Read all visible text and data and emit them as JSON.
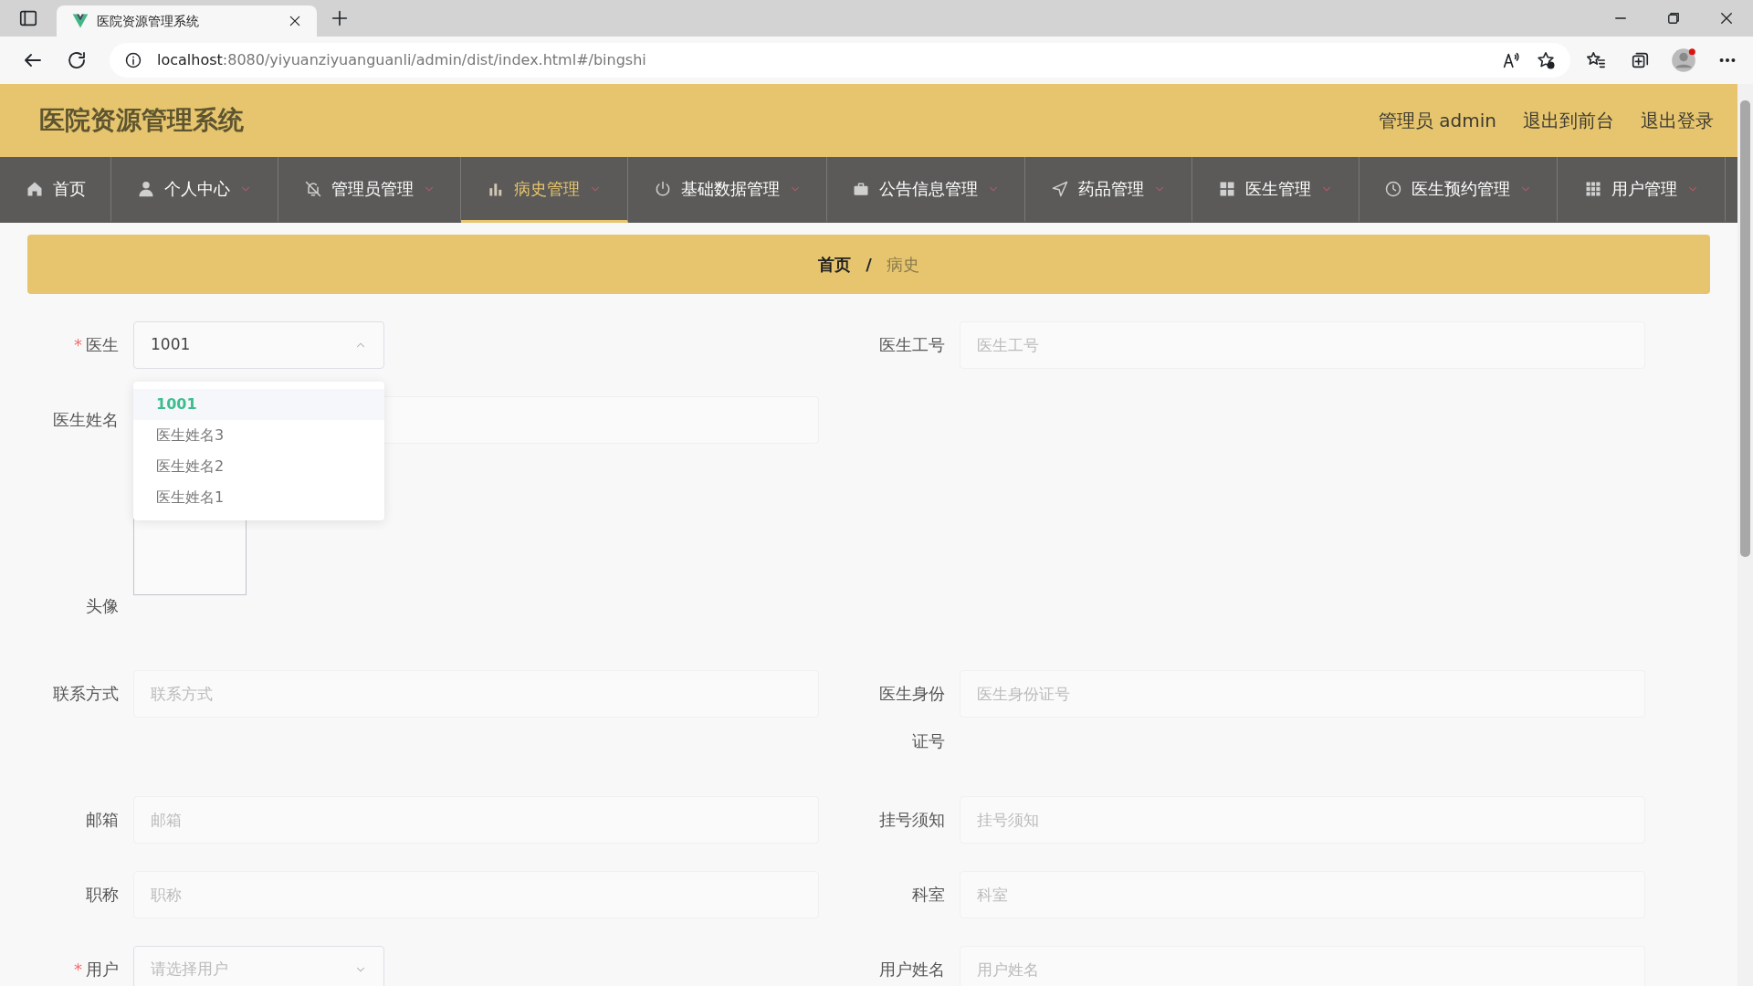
{
  "browser": {
    "tab_title": "医院资源管理系统",
    "url_host": "localhost",
    "url_rest": ":8080/yiyuanziyuanguanli/admin/dist/index.html#/bingshi"
  },
  "header": {
    "title": "医院资源管理系统",
    "user_label": "管理员 admin",
    "links": [
      "退出到前台",
      "退出登录"
    ]
  },
  "nav": [
    {
      "label": "首页",
      "dropdown": false,
      "selected": false
    },
    {
      "label": "个人中心",
      "dropdown": true,
      "selected": false
    },
    {
      "label": "管理员管理",
      "dropdown": true,
      "selected": false
    },
    {
      "label": "病史管理",
      "dropdown": true,
      "selected": true
    },
    {
      "label": "基础数据管理",
      "dropdown": true,
      "selected": false
    },
    {
      "label": "公告信息管理",
      "dropdown": true,
      "selected": false
    },
    {
      "label": "药品管理",
      "dropdown": true,
      "selected": false
    },
    {
      "label": "医生管理",
      "dropdown": true,
      "selected": false
    },
    {
      "label": "医生预约管理",
      "dropdown": true,
      "selected": false
    },
    {
      "label": "用户管理",
      "dropdown": true,
      "selected": false
    }
  ],
  "breadcrumb": {
    "separator": "/",
    "items": [
      {
        "label": "首页",
        "current": false
      },
      {
        "label": "病史",
        "current": true
      }
    ]
  },
  "form": {
    "rows": [
      {
        "left": {
          "kind": "select",
          "required_mark": "*",
          "label": "医生",
          "value": "1001",
          "open": true
        },
        "right": {
          "kind": "input",
          "label": "医生工号",
          "placeholder": "医生工号"
        }
      },
      {
        "left": {
          "kind": "input",
          "label": "医生姓名"
        }
      },
      {
        "left": {
          "kind": "upload",
          "label": "头像"
        }
      },
      {
        "left": {
          "kind": "input",
          "label": "联系方式",
          "placeholder": "联系方式"
        },
        "right": {
          "kind": "input",
          "label": "医生身份证号",
          "placeholder": "医生身份证号"
        }
      },
      {
        "left": {
          "kind": "input",
          "label": "邮箱",
          "placeholder": "邮箱"
        },
        "right": {
          "kind": "input",
          "label": "挂号须知",
          "placeholder": "挂号须知"
        }
      },
      {
        "left": {
          "kind": "input",
          "label": "职称",
          "placeholder": "职称"
        },
        "right": {
          "kind": "input",
          "label": "科室",
          "placeholder": "科室"
        }
      },
      {
        "left": {
          "kind": "select",
          "required_mark": "*",
          "label": "用户",
          "placeholder": "请选择用户",
          "open": false
        },
        "right": {
          "kind": "input",
          "label": "用户姓名",
          "placeholder": "用户姓名"
        }
      }
    ],
    "dropdown": [
      {
        "label": "1001",
        "selected": true
      },
      {
        "label": "医生姓名3",
        "selected": false
      },
      {
        "label": "医生姓名2",
        "selected": false
      },
      {
        "label": "医生姓名1",
        "selected": false
      }
    ]
  }
}
